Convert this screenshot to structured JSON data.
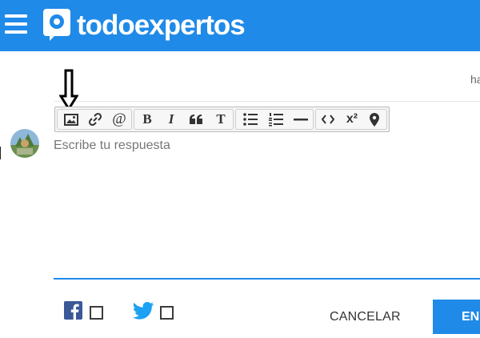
{
  "header": {
    "logo_text": "todoexpertos",
    "brand_color": "#1f8ae8"
  },
  "page": {
    "partial_text_top_right": "ha"
  },
  "toolbar": {
    "buttons": [
      {
        "name": "image",
        "icon": "image-icon",
        "label": ""
      },
      {
        "name": "link",
        "icon": "link-icon",
        "label": ""
      },
      {
        "name": "mention",
        "icon": "at-icon",
        "label": "@"
      },
      {
        "name": "bold",
        "icon": "bold-icon",
        "label": "B"
      },
      {
        "name": "italic",
        "icon": "italic-icon",
        "label": "I"
      },
      {
        "name": "quote",
        "icon": "quote-icon",
        "label": "66"
      },
      {
        "name": "text",
        "icon": "text-icon",
        "label": "T"
      },
      {
        "name": "bullet-list",
        "icon": "bullet-list-icon",
        "label": ""
      },
      {
        "name": "numbered-list",
        "icon": "numbered-list-icon",
        "label": ""
      },
      {
        "name": "horizontal-rule",
        "icon": "horizontal-rule-icon",
        "label": ""
      },
      {
        "name": "code",
        "icon": "code-icon",
        "label": "<>"
      },
      {
        "name": "superscript",
        "icon": "superscript-icon",
        "label": "x²"
      },
      {
        "name": "location",
        "icon": "map-pin-icon",
        "label": ""
      }
    ]
  },
  "editor": {
    "placeholder": "Escribe tu respuesta",
    "value": ""
  },
  "share": {
    "facebook_checked": false,
    "twitter_checked": false
  },
  "actions": {
    "cancel_label": "CANCELAR",
    "send_label_visible": "EN"
  }
}
